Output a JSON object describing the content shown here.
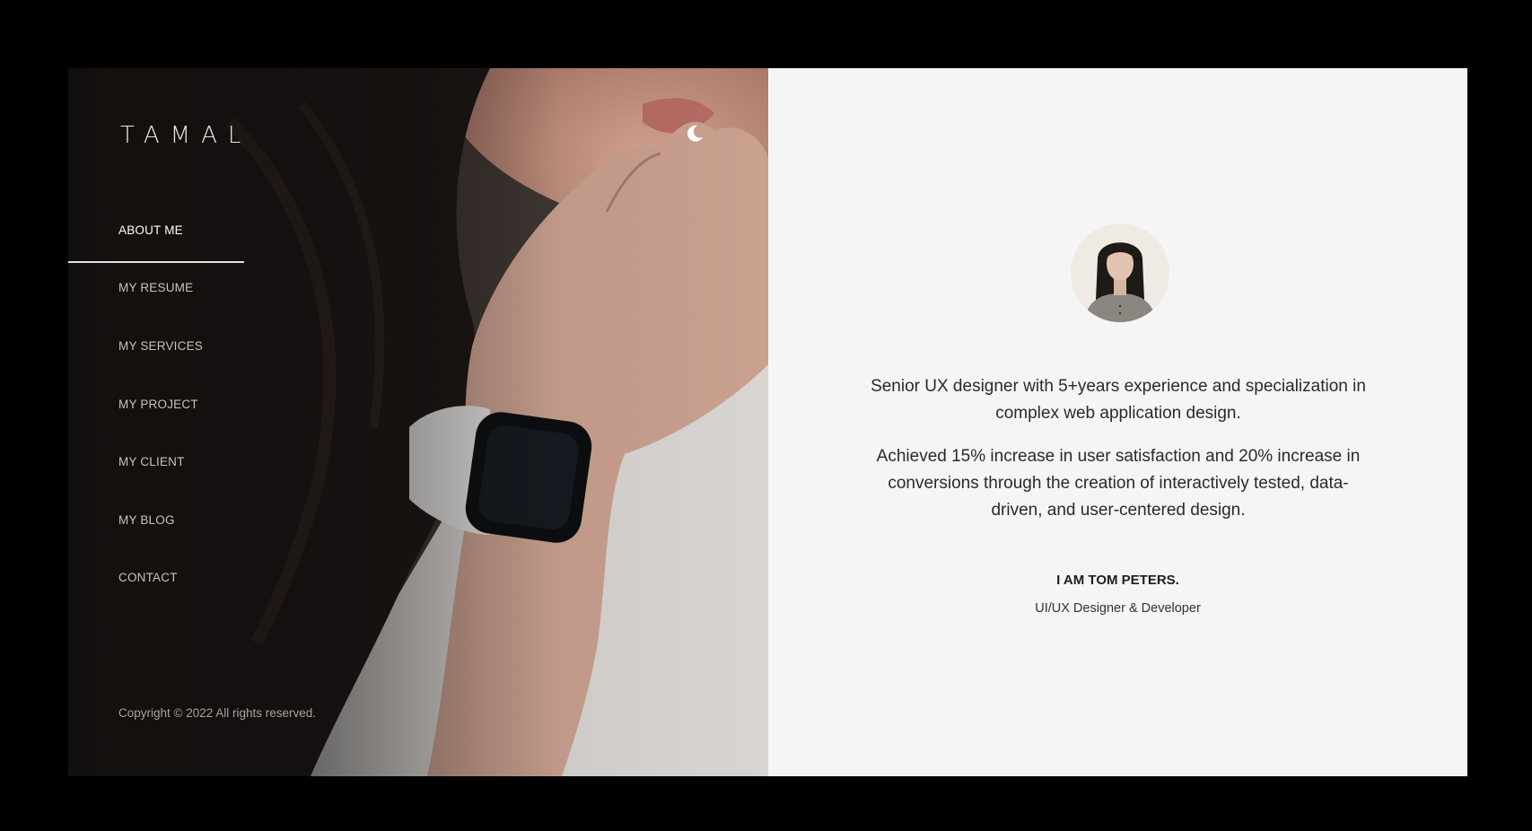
{
  "sidebar": {
    "logo": "TAMAL",
    "theme_toggle_icon": "moon-icon",
    "nav": [
      {
        "label": "ABOUT ME",
        "active": true
      },
      {
        "label": "MY RESUME",
        "active": false
      },
      {
        "label": "MY SERVICES",
        "active": false
      },
      {
        "label": "MY PROJECT",
        "active": false
      },
      {
        "label": "MY CLIENT",
        "active": false
      },
      {
        "label": "MY BLOG",
        "active": false
      },
      {
        "label": "CONTACT",
        "active": false
      }
    ],
    "copyright": "Copyright © 2022 All rights reserved."
  },
  "about": {
    "intro": "Senior UX designer with 5+years experience and specialization in complex web application design.",
    "achievement": "Achieved 15% increase in user satisfaction and 20% increase in conversions through the creation of interactively tested, data-driven, and user-centered design.",
    "name": "I AM TOM PETERS.",
    "role": "UI/UX Designer & Developer"
  },
  "colors": {
    "page_background": "#000000",
    "content_background": "#f5f5f5",
    "active_nav": "#ffffff"
  }
}
